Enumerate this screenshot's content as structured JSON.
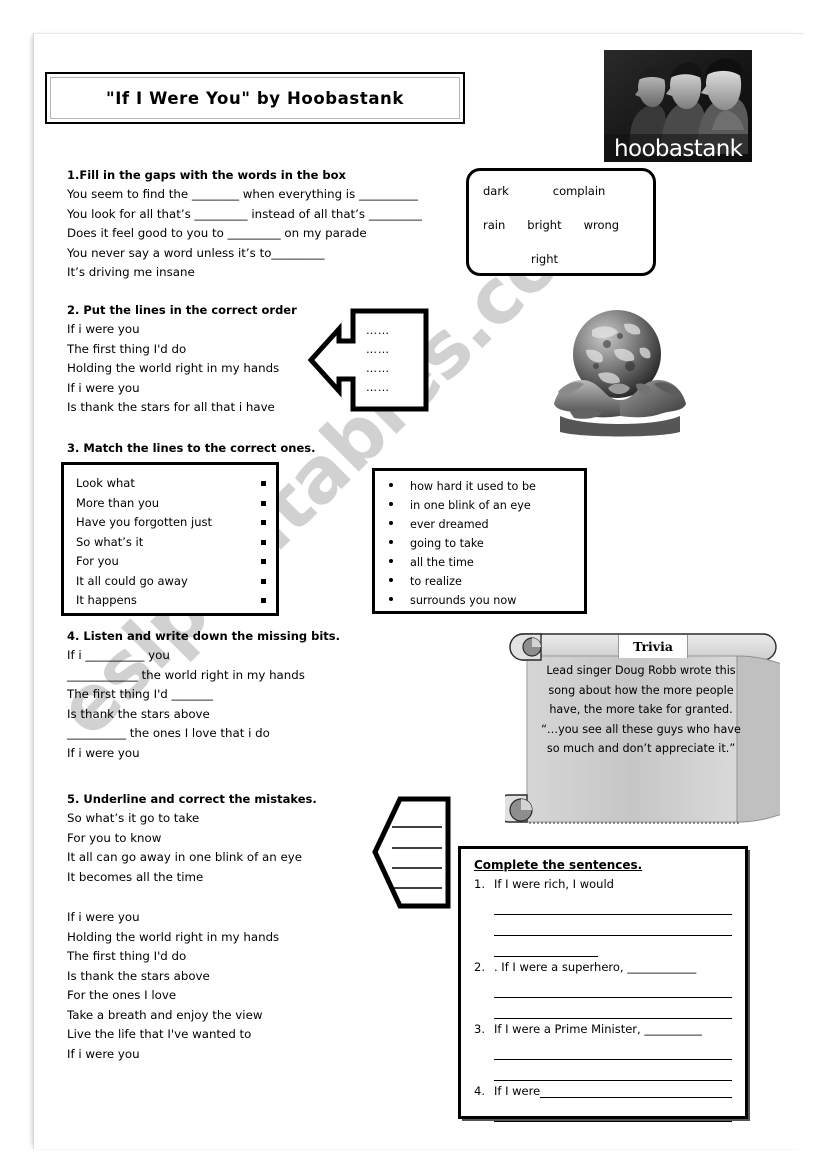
{
  "page": {
    "title": "\"If I Were You\" by Hoobastank",
    "watermark": "eslprintables.com"
  },
  "band_photo": {
    "logo_text": "hoobastank",
    "alt": "hoobastank band members in profile"
  },
  "section1": {
    "heading": "1.Fill in the gaps with the words in the box",
    "lines": [
      "You seem to find the ________ when everything is __________",
      "You look for all that’s _________ instead of all that’s _________",
      "Does it feel good to you to _________ on my parade",
      "You never say a word unless it’s to_________",
      "It’s driving me insane"
    ],
    "wordbox": {
      "row1": [
        "dark",
        "complain"
      ],
      "row2": [
        "rain",
        "bright",
        "wrong"
      ],
      "row3": [
        "right"
      ]
    }
  },
  "section2": {
    "heading": "2. Put the lines in the correct order",
    "lines": [
      "If i were you",
      "The first thing I'd do",
      "Holding the world right in my hands",
      "If i were you",
      "Is thank the stars for all that i have"
    ],
    "answer_box_dots": [
      "……",
      "……",
      "……",
      "……",
      "……"
    ]
  },
  "section3": {
    "heading": "3. Match the lines to the correct ones.",
    "left_items": [
      "Look what",
      "More than you",
      "Have you forgotten just",
      "So what’s it",
      "For you",
      "It all could go away",
      "It happens"
    ],
    "right_items": [
      "how hard it used to be",
      "in one blink of an eye",
      "ever dreamed",
      "going to take",
      "all the time",
      "to realize",
      "surrounds you now"
    ]
  },
  "section4": {
    "heading": "4. Listen and write down the missing bits.",
    "lines": [
      "If i __________ you",
      "____________ the world right in my hands",
      "The first thing I'd _______",
      "Is thank the stars above",
      "__________ the ones I love that i do",
      "If i were you"
    ]
  },
  "trivia": {
    "label": "Trivia",
    "text": "Lead singer Doug Robb wrote this song about how the more people have, the more take for granted. “…you see all these guys who have so much and don’t appreciate it.”"
  },
  "section5": {
    "heading": "5. Underline and correct the mistakes.",
    "lines": [
      "So what’s it go to take",
      "For you to know",
      "It all can go away in one blink of an eye",
      "It becomes all the time"
    ],
    "answer_lines_count": 4
  },
  "final_lyrics": {
    "lines": [
      "If i were you",
      "Holding the world right in my hands",
      "The first thing I'd do",
      "Is thank the stars above",
      "For the ones I love",
      "Take a breath and enjoy the view",
      "Live the life that I've wanted to",
      "If i were you"
    ]
  },
  "complete_sentences": {
    "title": "Complete the sentences.",
    "items": [
      {
        "num": "1.",
        "text": "If I were rich, I would"
      },
      {
        "num": "2.",
        "text": ". If I were a superhero, ____________"
      },
      {
        "num": "3.",
        "text": "If I were a Prime Minister, __________"
      },
      {
        "num": "4.",
        "text": "If I were"
      }
    ]
  }
}
